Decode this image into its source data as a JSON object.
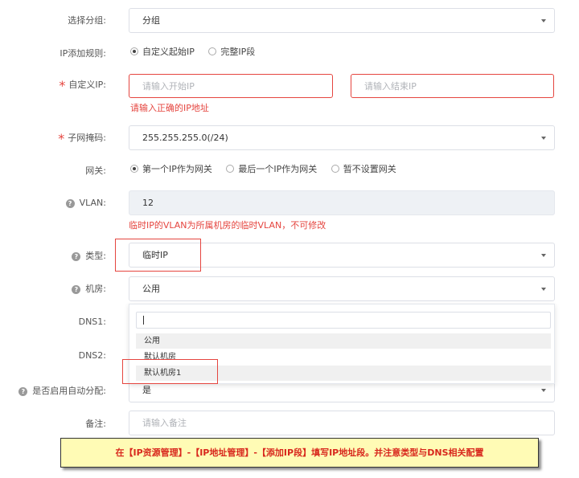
{
  "group": {
    "label": "选择分组:",
    "value": "分组"
  },
  "ip_rule": {
    "label": "IP添加规则:",
    "options": [
      "自定义起始IP",
      "完整IP段"
    ],
    "selected": 0
  },
  "custom_ip": {
    "label": "自定义IP:",
    "start_placeholder": "请输入开始IP",
    "end_placeholder": "请输入结束IP",
    "error": "请输入正确的IP地址"
  },
  "subnet": {
    "label": "子网掩码:",
    "value": "255.255.255.0(/24)"
  },
  "gateway": {
    "label": "网关:",
    "options": [
      "第一个IP作为网关",
      "最后一个IP作为网关",
      "暂不设置网关"
    ],
    "selected": 0
  },
  "vlan": {
    "label": "VLAN:",
    "value": "12",
    "hint": "临时IP的VLAN为所属机房的临时VLAN，不可修改"
  },
  "type": {
    "label": "类型:",
    "value": "临时IP"
  },
  "room": {
    "label": "机房:",
    "value": "公用"
  },
  "dropdown": {
    "options": [
      "公用",
      "默认机房",
      "默认机房1"
    ]
  },
  "dns1": {
    "label": "DNS1:"
  },
  "dns2": {
    "label": "DNS2:"
  },
  "auto_assign": {
    "label": "是否启用自动分配:",
    "value": "是"
  },
  "remark": {
    "label": "备注:",
    "placeholder": "请输入备注"
  },
  "instruction": "在【IP资源管理】-【IP地址管理】-【添加IP段】填写IP地址段。并注意类型与DNS相关配置",
  "colors": {
    "error": "#e5453f",
    "note_bg": "#fffbb5",
    "note_text": "#d8281d"
  }
}
